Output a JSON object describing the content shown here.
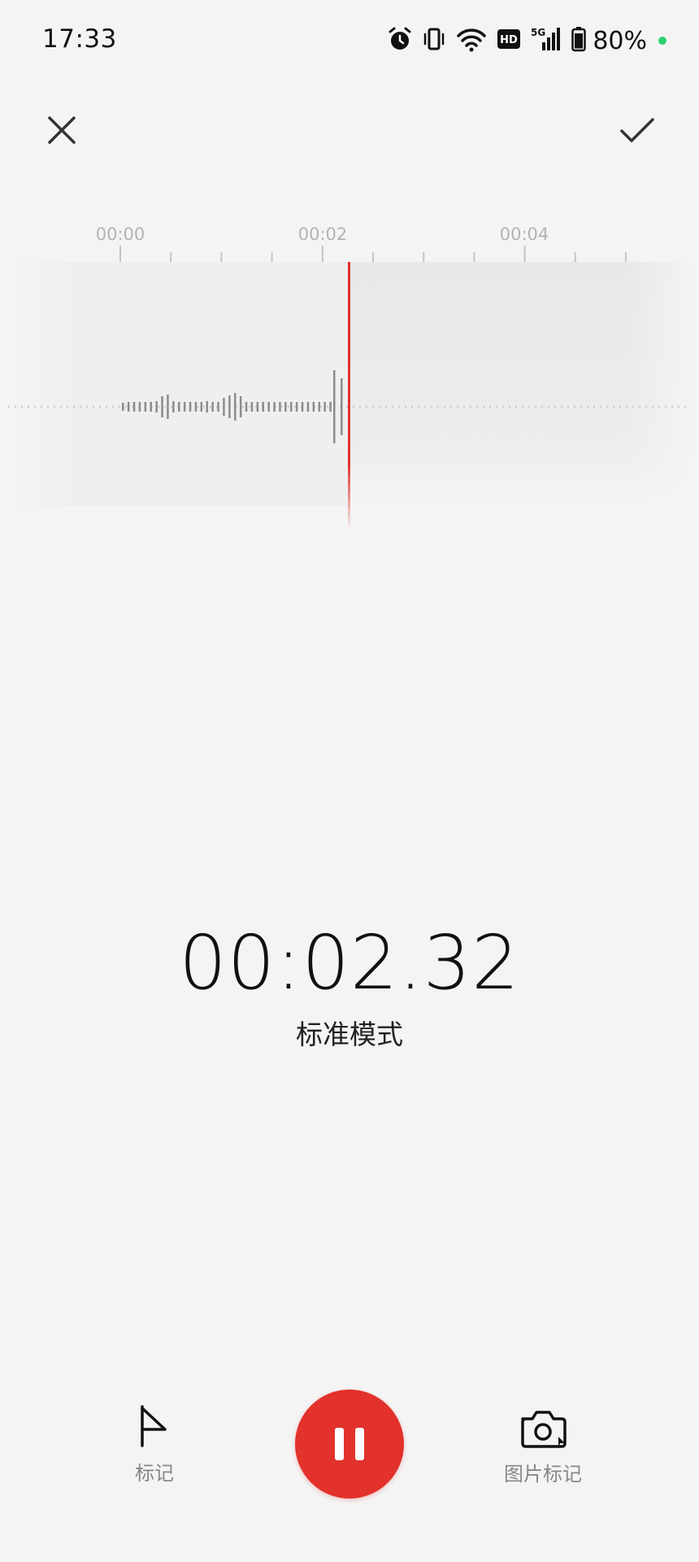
{
  "status_bar": {
    "time": "17:33",
    "battery": "80%",
    "icons": [
      "alarm-icon",
      "vibrate-icon",
      "wifi-icon",
      "hd-icon",
      "signal-5g-icon",
      "battery-icon"
    ]
  },
  "header": {
    "close_icon": "close-icon",
    "confirm_icon": "check-icon"
  },
  "timeline": {
    "tick_labels": [
      "00:00",
      "00:02",
      "00:04"
    ],
    "playhead_color": "#e3312b"
  },
  "recorder": {
    "elapsed": "00:02.32",
    "mode": "标准模式"
  },
  "controls": {
    "mark_label": "标记",
    "photo_mark_label": "图片标记",
    "pause_color": "#e3312b"
  }
}
